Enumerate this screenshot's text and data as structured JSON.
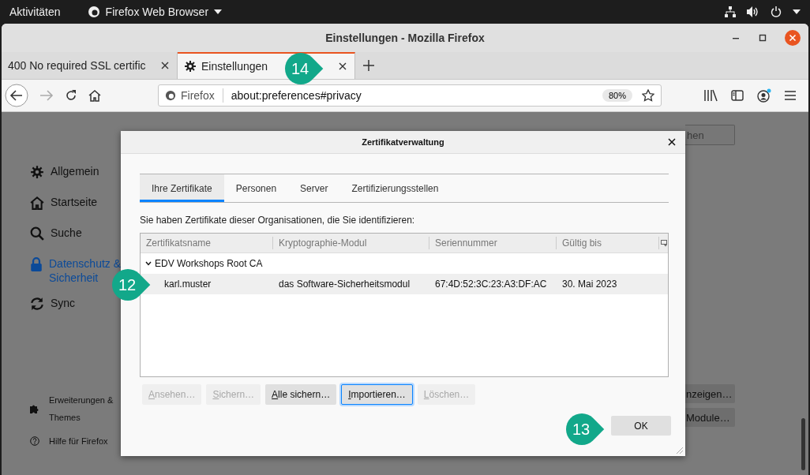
{
  "top_bar": {
    "activities": "Aktivitäten",
    "app_menu": "Firefox Web Browser"
  },
  "window": {
    "title": "Einstellungen - Mozilla Firefox"
  },
  "tabs": [
    {
      "label": "400 No required SSL certific",
      "kind": "page",
      "selected": false
    },
    {
      "label": "Einstellungen",
      "kind": "settings",
      "selected": true
    }
  ],
  "url_bar": {
    "identity": "Firefox",
    "value": "about:preferences#privacy",
    "zoom": "80%"
  },
  "sidebar": {
    "items": [
      {
        "label": "Allgemein",
        "kind": "general",
        "selected": false
      },
      {
        "label": "Startseite",
        "kind": "home",
        "selected": false
      },
      {
        "label": "Suche",
        "kind": "search",
        "selected": false
      },
      {
        "label": "Datenschutz & Sicherheit",
        "kind": "privacy",
        "selected": true
      },
      {
        "label": "Sync",
        "kind": "sync",
        "selected": false
      }
    ],
    "footer": [
      {
        "label": "Erweiterungen & Themes",
        "kind": "extensions"
      },
      {
        "label": "Hilfe für Firefox",
        "kind": "help"
      }
    ]
  },
  "page": {
    "search": {
      "placeholder": "hen"
    },
    "buttons": [
      "nzeigen…",
      "Module…"
    ]
  },
  "dialog": {
    "title": "Zertifikatverwaltung",
    "tabs": [
      {
        "label": "Ihre Zertifikate",
        "selected": true
      },
      {
        "label": "Personen",
        "selected": false
      },
      {
        "label": "Server",
        "selected": false
      },
      {
        "label": "Zertifizierungsstellen",
        "selected": false
      }
    ],
    "description": "Sie haben Zertifikate dieser Organisationen, die Sie identifizieren:",
    "columns": [
      "Zertifikatsname",
      "Kryptographie-Modul",
      "Seriennummer",
      "Gültig bis"
    ],
    "groups": [
      {
        "name": "EDV Workshops Root CA",
        "expanded": true,
        "children": [
          {
            "name": "karl.muster",
            "module": "das Software-Sicherheitsmodul",
            "serial": "67:4D:52:3C:23:A3:DF:AC",
            "expires": "30. Mai 2023",
            "selected": true
          }
        ]
      }
    ],
    "buttons": [
      {
        "label": "Ansehen…",
        "disabled": true,
        "focused": false
      },
      {
        "label": "Sichern…",
        "disabled": true,
        "focused": false
      },
      {
        "label": "Alle sichern…",
        "disabled": false,
        "focused": false
      },
      {
        "label": "Importieren…",
        "disabled": false,
        "focused": true
      },
      {
        "label": "Löschen…",
        "disabled": true,
        "focused": false
      }
    ],
    "ok": "OK"
  },
  "callouts": [
    {
      "label": "14"
    },
    {
      "label": "12"
    },
    {
      "label": "13"
    }
  ]
}
